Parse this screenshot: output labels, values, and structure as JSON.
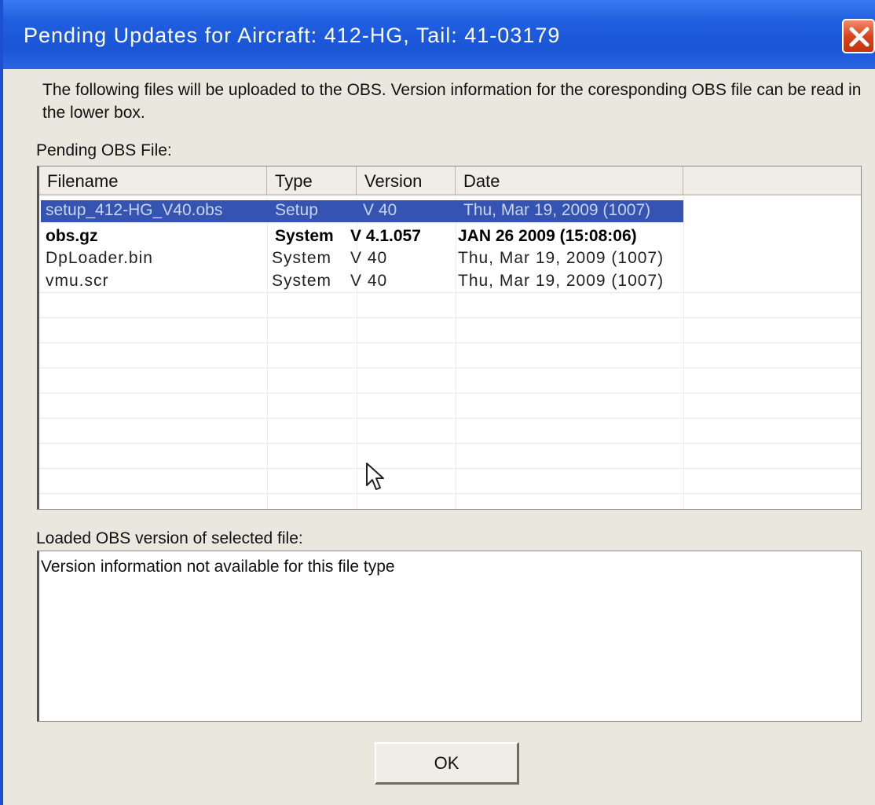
{
  "window": {
    "title": "Pending Updates for Aircraft: 412-HG, Tail: 41-03179"
  },
  "intro": {
    "text": "The following files will be uploaded to the OBS.  Version information for the coresponding OBS file can be read in the lower box."
  },
  "pending": {
    "label": "Pending OBS File:",
    "columns": [
      "Filename",
      "Type",
      "Version",
      "Date"
    ],
    "rows": [
      {
        "filename": "setup_412-HG_V40.obs",
        "type": "Setup",
        "version": "V 40",
        "date": "Thu, Mar 19, 2009 (1007)",
        "selected": true
      },
      {
        "filename": "obs.gz",
        "type": "System",
        "version": "V 4.1.057",
        "date": "JAN 26 2009 (15:08:06)",
        "bold": true
      },
      {
        "filename": "DpLoader.bin",
        "type": "System",
        "version": "V 40",
        "date": "Thu, Mar 19, 2009 (1007)"
      },
      {
        "filename": "vmu.scr",
        "type": "System",
        "version": "V 40",
        "date": "Thu, Mar 19, 2009 (1007)"
      }
    ]
  },
  "loaded": {
    "label": "Loaded OBS version of selected file:",
    "text": "Version information not available for this file type"
  },
  "buttons": {
    "ok": "OK"
  },
  "colors": {
    "titlebar": "#1f5fe0",
    "selection": "#3553b0",
    "close": "#d9441f"
  },
  "icons": [
    "close-icon",
    "mouse-cursor-icon"
  ]
}
